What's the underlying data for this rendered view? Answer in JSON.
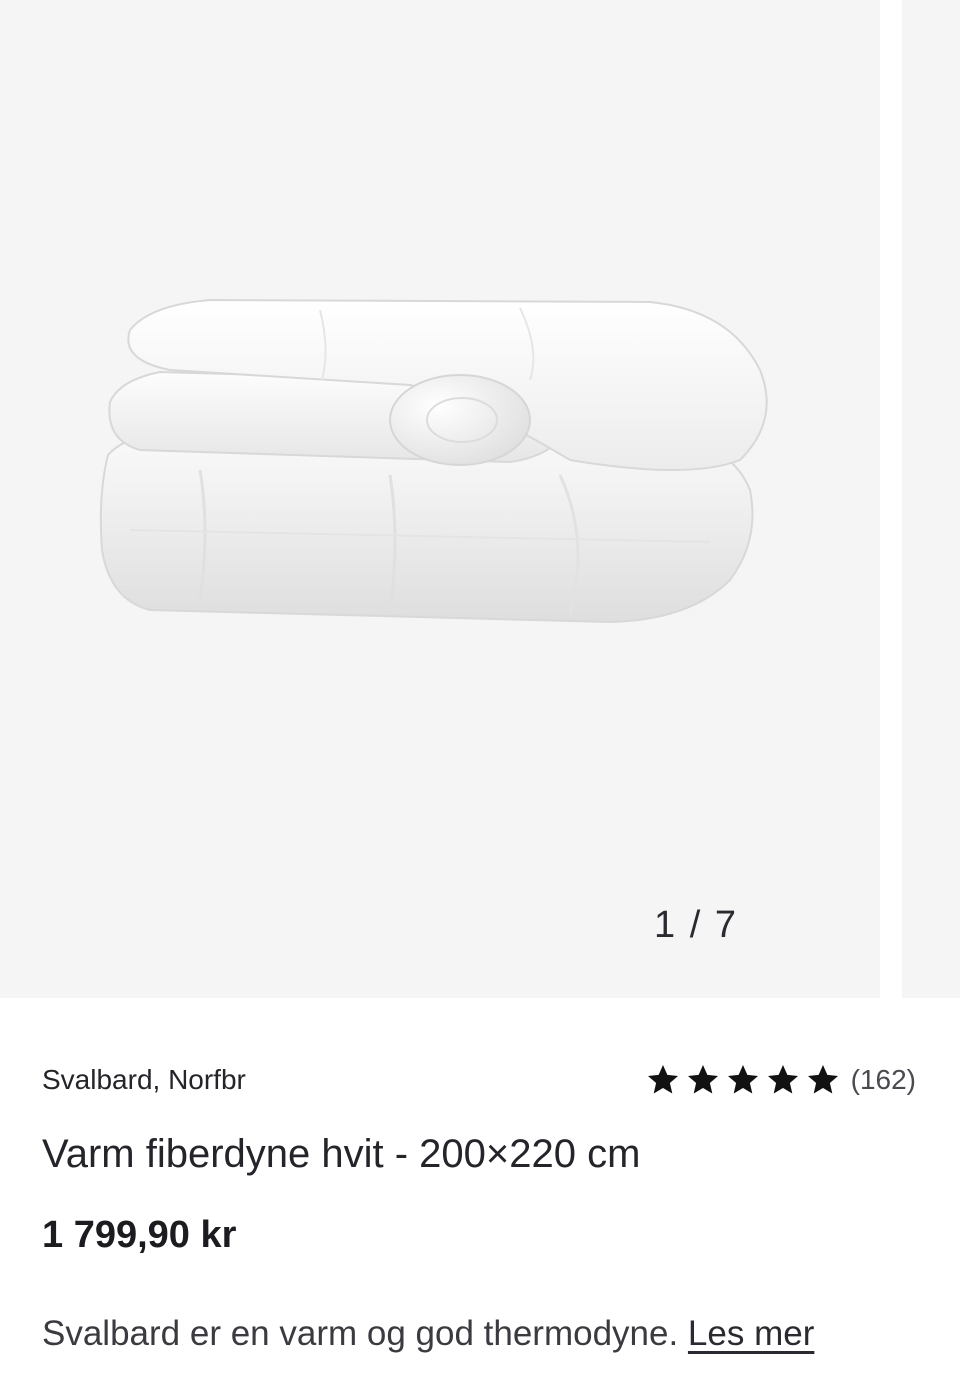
{
  "gallery": {
    "counter": "1 / 7",
    "image_alt": "Varm fiberdyne hvit",
    "background": "#f5f5f5"
  },
  "product": {
    "brand": "Svalbard, Norfbr",
    "title": "Varm fiberdyne hvit - 200×220 cm",
    "price": "1 799,90 kr",
    "rating": {
      "stars": 5,
      "max_stars": 5,
      "count": "(162)",
      "star_icon": "star-icon",
      "star_color": "#111111"
    },
    "description": "Svalbard er en varm og god thermodyne.",
    "read_more": "Les mer"
  }
}
